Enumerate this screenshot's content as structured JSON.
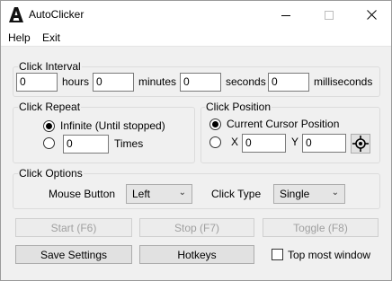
{
  "window": {
    "title": "AutoClicker"
  },
  "menu": {
    "items": [
      "Help",
      "Exit"
    ]
  },
  "click_interval": {
    "title": "Click Interval",
    "hours_value": "0",
    "hours_label": "hours",
    "minutes_value": "0",
    "minutes_label": "minutes",
    "seconds_value": "0",
    "seconds_label": "seconds",
    "ms_value": "0",
    "ms_label": "milliseconds"
  },
  "click_repeat": {
    "title": "Click Repeat",
    "infinite_label": "Infinite (Until stopped)",
    "infinite_selected": true,
    "times_value": "0",
    "times_label": "Times"
  },
  "click_position": {
    "title": "Click Position",
    "current_label": "Current Cursor Position",
    "current_selected": true,
    "x_label": "X",
    "x_value": "0",
    "y_label": "Y",
    "y_value": "0"
  },
  "click_options": {
    "title": "Click Options",
    "mouse_button_label": "Mouse Button",
    "mouse_button_value": "Left",
    "click_type_label": "Click Type",
    "click_type_value": "Single"
  },
  "actions": {
    "start": "Start (F6)",
    "stop": "Stop (F7)",
    "toggle": "Toggle (F8)",
    "save": "Save Settings",
    "hotkeys": "Hotkeys",
    "topmost_label": "Top most window",
    "topmost_checked": false
  }
}
